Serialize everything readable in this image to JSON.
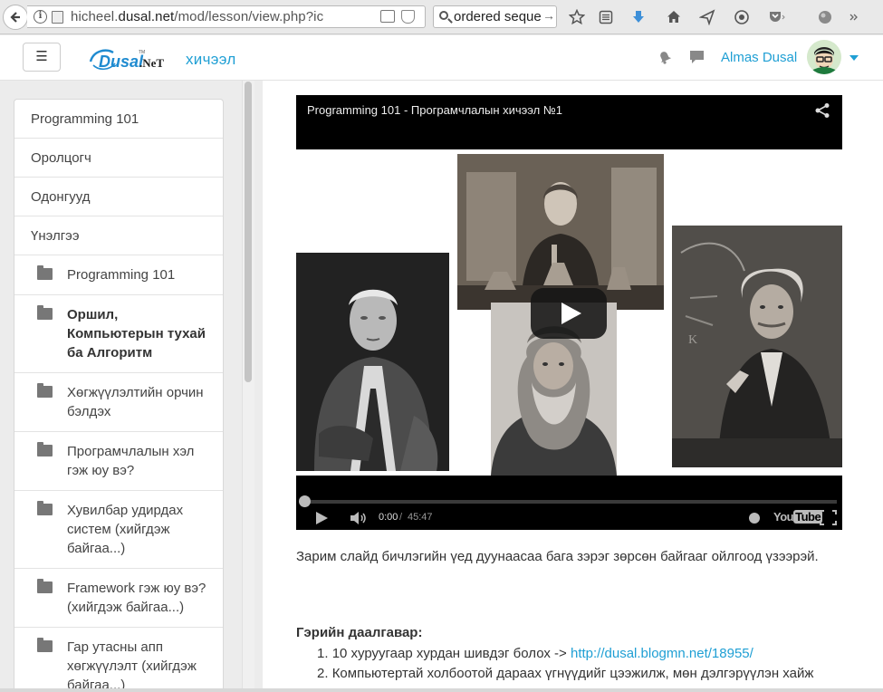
{
  "browser": {
    "url_prefix": "hicheel.",
    "url_host": "dusal.net",
    "url_path": "/mod/lesson/view.php?ic",
    "search_value": "ordered seque",
    "go_glyph": "→"
  },
  "header": {
    "menu_glyph": "☰",
    "logo_text": "Dusal",
    "logo_suffix": ".NeT",
    "logo_tm": "TM",
    "brand_title": "хичээл",
    "user_name": "Almas Dusal"
  },
  "sidebar": {
    "top_items": [
      {
        "label": "Programming 101"
      },
      {
        "label": "Оролцогч"
      },
      {
        "label": "Одонгууд"
      },
      {
        "label": "Үнэлгээ"
      }
    ],
    "pages": [
      {
        "label": "Programming 101",
        "active": false
      },
      {
        "label": "Оршил, Компьютерын тухай ба Алгоритм",
        "active": true
      },
      {
        "label": "Хөгжүүлэлтийн орчин бэлдэх",
        "active": false
      },
      {
        "label": "Програмчлалын хэл гэж юу вэ?",
        "active": false
      },
      {
        "label": "Хувилбар удирдах систем (хийгдэж байгаа...)",
        "active": false
      },
      {
        "label": "Framework гэж юу вэ? (хийгдэж байгаа...)",
        "active": false
      },
      {
        "label": "Гар утасны апп хөгжүүлэлт (хийгдэж байгаа...)",
        "active": false
      }
    ]
  },
  "video": {
    "title": "Programming 101 - Програмчлалын хичээл №1",
    "progress": 0,
    "time_current": "0:00",
    "time_separator": "/",
    "time_total": "45:47",
    "youtube_label_a": "You",
    "youtube_label_b": "Tube"
  },
  "content": {
    "paragraph": "Зарим слайд бичлэгийн үед дуунаасаа бага зэрэг зөрсөн байгааг ойлгоод үзээрэй.",
    "homework_title": "Гэрийн даалгавар:",
    "homework": [
      {
        "number": "1.",
        "text": "10 хуруугаар хурдан шивдэг болох -> ",
        "link": "http://dusal.blogmn.net/18955/"
      },
      {
        "number": "2.",
        "text": "Компьютертай холбоотой дараах үгнүүдийг цээжилж, мөн дэлгэрүүлэн хайж",
        "link": ""
      }
    ]
  },
  "colors": {
    "accent": "#1f9fd4",
    "video_bg": "#000000",
    "sidebar_border": "#d9d9d9"
  },
  "icons": [
    "back-arrow-icon",
    "info-icon",
    "page-icon",
    "reader-icon",
    "pocket-icon",
    "search-icon",
    "star-icon",
    "reading-list-icon",
    "download-icon",
    "home-icon",
    "send-icon",
    "addon-icon",
    "pocket-toolbar-icon",
    "ball-icon",
    "bell-icon",
    "chat-icon",
    "share-icon",
    "play-icon",
    "volume-icon",
    "clock-icon",
    "fullscreen-icon",
    "folder-icon"
  ]
}
